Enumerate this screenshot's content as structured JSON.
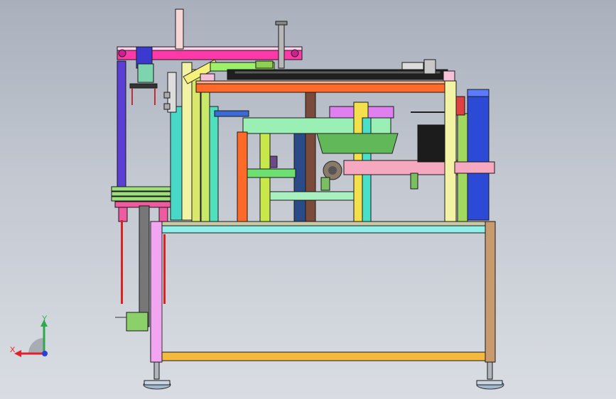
{
  "triad": {
    "x_label": "X",
    "y_label": "Y"
  },
  "colors": {
    "background_top": "#a9b0bc",
    "background_bottom": "#d9dde3",
    "x_axis": "#e0202a",
    "y_axis": "#2ea84a",
    "z_axis": "#2a3fd8"
  }
}
